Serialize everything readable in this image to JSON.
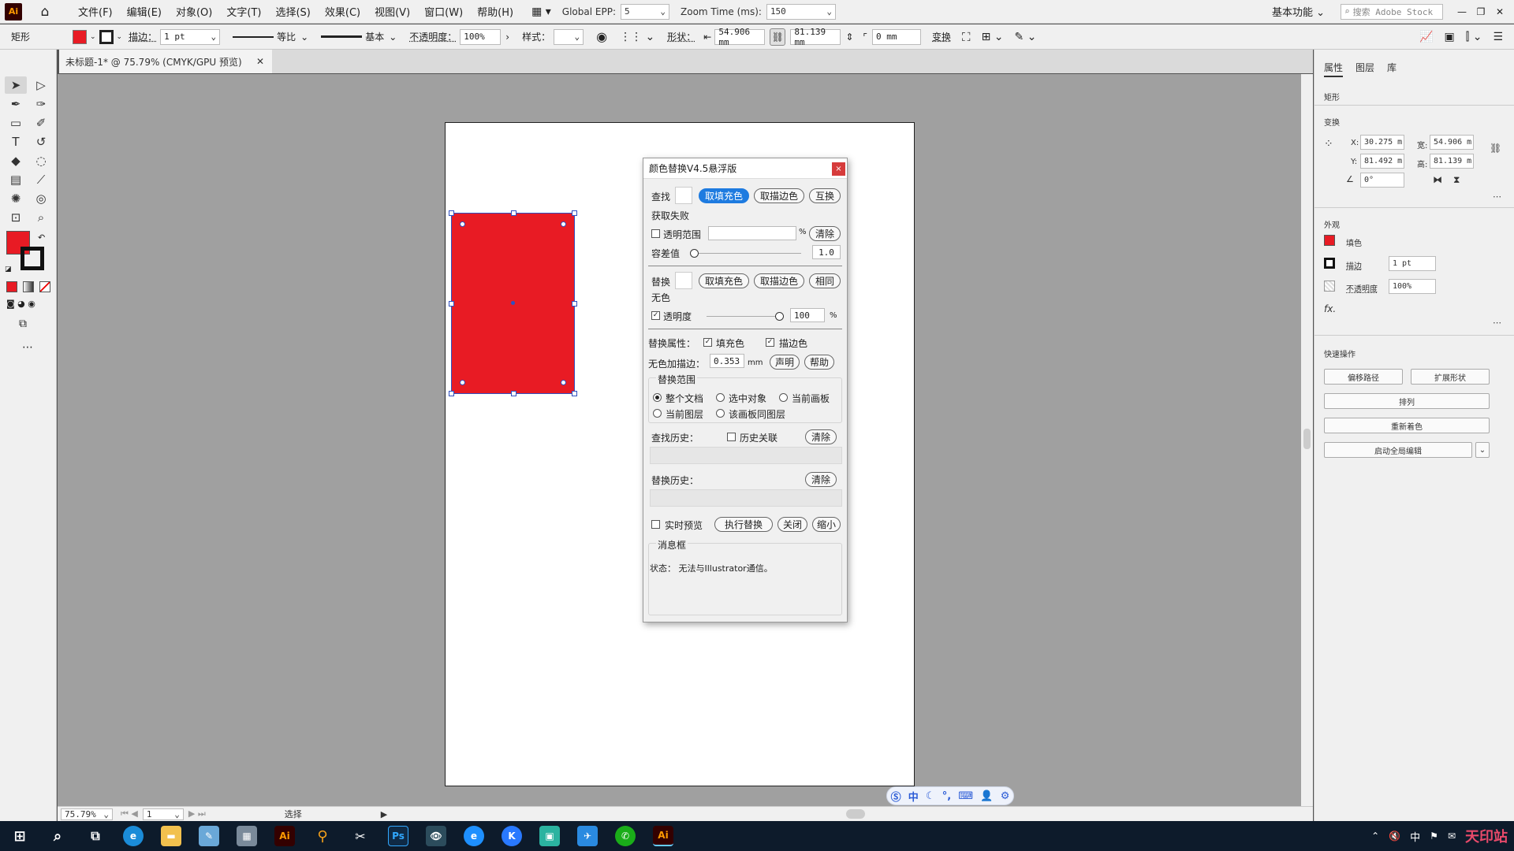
{
  "menubar": {
    "logo": "Ai",
    "items": [
      "文件(F)",
      "编辑(E)",
      "对象(O)",
      "文字(T)",
      "选择(S)",
      "效果(C)",
      "视图(V)",
      "窗口(W)",
      "帮助(H)"
    ],
    "global_epp_label": "Global EPP:",
    "global_epp_value": "5",
    "zoom_time_label": "Zoom Time (ms):",
    "zoom_time_value": "150",
    "workspace": "基本功能",
    "search_placeholder": "搜索 Adobe Stock"
  },
  "optbar": {
    "object_type": "矩形",
    "stroke_label": "描边：",
    "stroke_value": "1 pt",
    "stroke_profile": "等比",
    "brush": "基本",
    "opacity_label": "不透明度：",
    "opacity_value": "100%",
    "style_label": "样式：",
    "shape_label": "形状：",
    "width_value": "54.906 mm",
    "height_value": "81.139 mm",
    "corner_value": "0 mm",
    "transform_label": "变换",
    "fill_color": "#e81b24"
  },
  "document": {
    "tab_title": "未标题-1* @ 75.79% (CMYK/GPU 预览)",
    "rect_color": "#e81b24"
  },
  "statusbar": {
    "zoom": "75.79%",
    "artboard": "1",
    "tool": "选择"
  },
  "dialog": {
    "title": "颜色替换V4.5悬浮版",
    "close": "×",
    "find_label": "查找",
    "btn_fill": "取填充色",
    "btn_stroke": "取描边色",
    "btn_swap": "互换",
    "status_fail": "获取失败",
    "transparency_range_label": "透明范围",
    "percent": "%",
    "btn_clear": "清除",
    "tolerance_label": "容差值",
    "tolerance_value": "1.0",
    "replace_label": "替换",
    "no_color": "无色",
    "btn_replace_fill": "取填充色",
    "btn_replace_stroke": "取描边色",
    "btn_same": "相同",
    "opacity_label": "透明度",
    "opacity_value": "100",
    "attr_label": "替换属性：",
    "attr_fill": "填充色",
    "attr_stroke": "描边色",
    "nocolor_stroke_label": "无色加描边：",
    "nocolor_stroke_value": "0.353",
    "mm": "mm",
    "btn_declare": "声明",
    "btn_help": "帮助",
    "scope_label": "替换范围",
    "scope_whole": "整个文档",
    "scope_selected": "选中对象",
    "scope_artboard": "当前画板",
    "scope_layer": "当前图层",
    "scope_same_layer": "该画板同图层",
    "find_history_label": "查找历史：",
    "history_link": "历史关联",
    "replace_history_label": "替换历史：",
    "realtime_label": "实时预览",
    "btn_execute": "执行替换",
    "btn_close": "关闭",
    "btn_shrink": "缩小",
    "message_title": "消息框",
    "message_text": "状态： 无法与Illustrator通信。"
  },
  "rpanel": {
    "tabs": [
      "属性",
      "图层",
      "库"
    ],
    "object": "矩形",
    "transform": "变换",
    "x_label": "X:",
    "x_value": "30.275 m",
    "y_label": "Y:",
    "y_value": "81.492 m",
    "w_label": "宽:",
    "w_value": "54.906 m",
    "h_label": "高:",
    "h_value": "81.139 m",
    "angle_value": "0°",
    "appearance": "外观",
    "fill_label": "填色",
    "stroke_label": "描边",
    "stroke_value": "1 pt",
    "opacity_label": "不透明度",
    "opacity_value": "100%",
    "fx": "fx.",
    "quick_actions": "快速操作",
    "btn_offset": "偏移路径",
    "btn_expand": "扩展形状",
    "btn_arrange": "排列",
    "btn_recolor": "重新着色",
    "btn_global_edit": "启动全局编辑"
  },
  "ime": {
    "lang": "中"
  },
  "taskbar": {
    "tray_lang": "中",
    "watermark": "天印站"
  }
}
